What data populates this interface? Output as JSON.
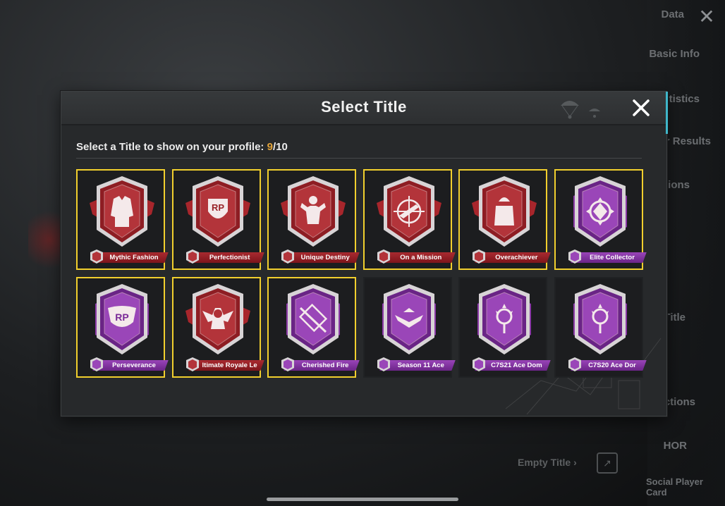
{
  "modal": {
    "title": "Select Title",
    "prompt_text": "Select a Title to show on your profile: ",
    "selected_count": "9",
    "max_count": "/10"
  },
  "titles": [
    {
      "label": "Mythic Fashion",
      "color": "red",
      "selected": true,
      "icon": "jacket-icon"
    },
    {
      "label": "Perfectionist",
      "color": "red",
      "selected": true,
      "icon": "rp-shield-icon"
    },
    {
      "label": "Unique Destiny",
      "color": "red",
      "selected": true,
      "icon": "flexing-figure-icon"
    },
    {
      "label": "On a Mission",
      "color": "red",
      "selected": true,
      "icon": "crosshair-gun-icon"
    },
    {
      "label": "Overachiever",
      "color": "red",
      "selected": true,
      "icon": "helmet-figure-icon"
    },
    {
      "label": "Elite Collector",
      "color": "purple",
      "selected": true,
      "icon": "gem-icon"
    },
    {
      "label": "Perseverance",
      "color": "purple",
      "selected": true,
      "icon": "rp-wings-icon"
    },
    {
      "label": "ltimate Royale Le",
      "color": "red",
      "selected": true,
      "icon": "winged-helmet-icon"
    },
    {
      "label": "Cherished Fire",
      "color": "purple",
      "selected": true,
      "icon": "sniper-rifle-icon"
    },
    {
      "label": "Season 11 Ace",
      "color": "purple",
      "selected": false,
      "icon": "chevron-wings-icon"
    },
    {
      "label": "C7S21 Ace Dom",
      "color": "purple",
      "selected": false,
      "icon": "pan-star-icon"
    },
    {
      "label": "C7S20 Ace Dor",
      "color": "purple",
      "selected": false,
      "icon": "pan-star-icon"
    }
  ],
  "background": {
    "data_label": "Data",
    "basic_info": "Basic Info",
    "statistics": "tistics",
    "results": "r Results",
    "options1": "ions",
    "title_tab": "Title",
    "options2": "ections",
    "honor": "HOR",
    "social_card": "Social Player Card",
    "empty_title": "Empty Title"
  },
  "colors": {
    "selected_border": "#f1cf2d",
    "count_accent": "#e3a43a",
    "red_badge": "#a82a30",
    "purple_badge": "#9944b8"
  }
}
